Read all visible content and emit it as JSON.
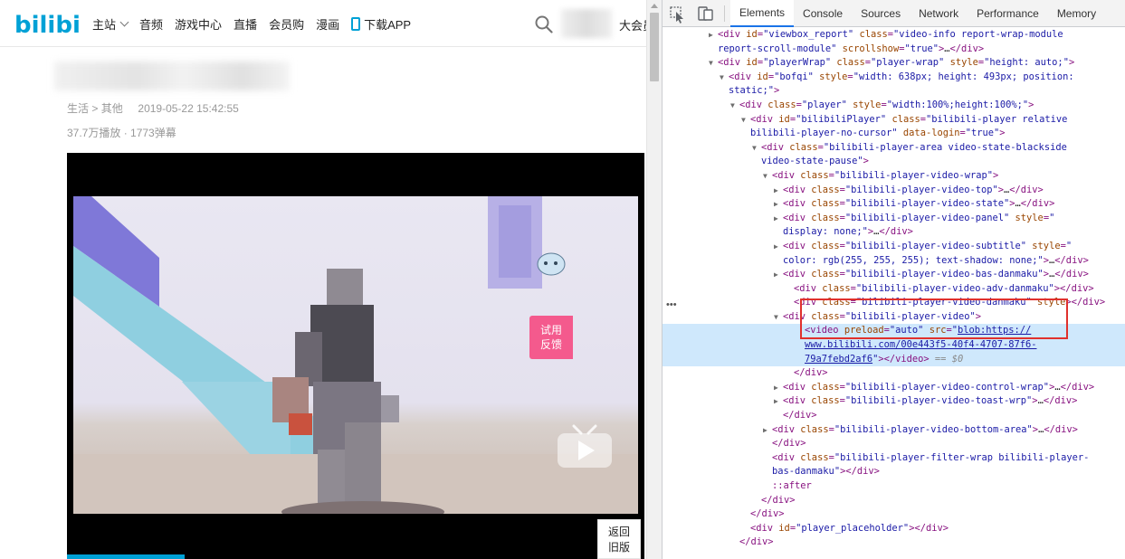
{
  "site": {
    "logo_text": "bilibili",
    "nav": [
      {
        "label": "主站",
        "has_chevron": true
      },
      {
        "label": "音频"
      },
      {
        "label": "游戏中心"
      },
      {
        "label": "直播"
      },
      {
        "label": "会员购"
      },
      {
        "label": "漫画"
      },
      {
        "label": "下载APP",
        "icon": "phone-icon"
      }
    ],
    "header_right_text": "大会员",
    "search_icon": "search-icon",
    "breadcrumb": {
      "part1": "生活",
      "sep": " > ",
      "part2": "其他",
      "timestamp": "2019-05-22 15:42:55"
    },
    "stats": {
      "plays": "37.7万播放",
      "sep": " · ",
      "danmaku": "1773弹幕"
    },
    "feedback_button": {
      "line1": "试用",
      "line2": "反馈"
    },
    "back_old_button": {
      "line1": "返回",
      "line2": "旧版"
    }
  },
  "devtools": {
    "tabs": [
      "Elements",
      "Console",
      "Sources",
      "Network",
      "Performance",
      "Memory"
    ],
    "active_tab": "Elements",
    "icons": [
      "inspect-icon",
      "device-icon"
    ],
    "dom_lines": [
      {
        "indent": 62,
        "tri": "▶",
        "html": "<span class=\"tn\">&lt;div</span> <span class=\"an\">id</span>=<span class=\"av\">\"viewbox_report\"</span> <span class=\"an\">class</span>=<span class=\"av\">\"video-info report-wrap-module</span>"
      },
      {
        "indent": 62,
        "tri": "",
        "html": "<span class=\"av\">report-scroll-module\"</span> <span class=\"an\">scrollshow</span>=<span class=\"av\">\"true\"</span><span class=\"tn\">&gt;</span><span class=\"tx\">…</span><span class=\"tn\">&lt;/div&gt;</span>"
      },
      {
        "indent": 62,
        "tri": "▼",
        "html": "<span class=\"tn\">&lt;div</span> <span class=\"an\">id</span>=<span class=\"av\">\"playerWrap\"</span> <span class=\"an\">class</span>=<span class=\"av\">\"player-wrap\"</span> <span class=\"an\">style</span>=<span class=\"av\">\"height: auto;\"</span><span class=\"tn\">&gt;</span>"
      },
      {
        "indent": 74,
        "tri": "▼",
        "html": "<span class=\"tn\">&lt;div</span> <span class=\"an\">id</span>=<span class=\"av\">\"bofqi\"</span> <span class=\"an\">style</span>=<span class=\"av\">\"width: 638px; height: 493px; position:</span>"
      },
      {
        "indent": 74,
        "tri": "",
        "html": "<span class=\"av\">static;\"</span><span class=\"tn\">&gt;</span>"
      },
      {
        "indent": 86,
        "tri": "▼",
        "html": "<span class=\"tn\">&lt;div</span> <span class=\"an\">class</span>=<span class=\"av\">\"player\"</span> <span class=\"an\">style</span>=<span class=\"av\">\"width:100%;height:100%;\"</span><span class=\"tn\">&gt;</span>"
      },
      {
        "indent": 98,
        "tri": "▼",
        "html": "<span class=\"tn\">&lt;div</span> <span class=\"an\">id</span>=<span class=\"av\">\"bilibiliPlayer\"</span> <span class=\"an\">class</span>=<span class=\"av\">\"bilibili-player relative</span>"
      },
      {
        "indent": 98,
        "tri": "",
        "html": "<span class=\"av\">bilibili-player-no-cursor\"</span> <span class=\"an\">data-login</span>=<span class=\"av\">\"true\"</span><span class=\"tn\">&gt;</span>"
      },
      {
        "indent": 110,
        "tri": "▼",
        "html": "<span class=\"tn\">&lt;div</span> <span class=\"an\">class</span>=<span class=\"av\">\"bilibili-player-area video-state-blackside</span>"
      },
      {
        "indent": 110,
        "tri": "",
        "html": "<span class=\"av\">video-state-pause\"</span><span class=\"tn\">&gt;</span>"
      },
      {
        "indent": 122,
        "tri": "▼",
        "html": "<span class=\"tn\">&lt;div</span> <span class=\"an\">class</span>=<span class=\"av\">\"bilibili-player-video-wrap\"</span><span class=\"tn\">&gt;</span>"
      },
      {
        "indent": 134,
        "tri": "▶",
        "html": "<span class=\"tn\">&lt;div</span> <span class=\"an\">class</span>=<span class=\"av\">\"bilibili-player-video-top\"</span><span class=\"tn\">&gt;</span><span class=\"tx\">…</span><span class=\"tn\">&lt;/div&gt;</span>"
      },
      {
        "indent": 134,
        "tri": "▶",
        "html": "<span class=\"tn\">&lt;div</span> <span class=\"an\">class</span>=<span class=\"av\">\"bilibili-player-video-state\"</span><span class=\"tn\">&gt;</span><span class=\"tx\">…</span><span class=\"tn\">&lt;/div&gt;</span>"
      },
      {
        "indent": 134,
        "tri": "▶",
        "html": "<span class=\"tn\">&lt;div</span> <span class=\"an\">class</span>=<span class=\"av\">\"bilibili-player-video-panel\"</span> <span class=\"an\">style</span>=<span class=\"av\">\"</span>"
      },
      {
        "indent": 134,
        "tri": "",
        "html": "<span class=\"av\">display: none;\"</span><span class=\"tn\">&gt;</span><span class=\"tx\">…</span><span class=\"tn\">&lt;/div&gt;</span>"
      },
      {
        "indent": 134,
        "tri": "▶",
        "html": "<span class=\"tn\">&lt;div</span> <span class=\"an\">class</span>=<span class=\"av\">\"bilibili-player-video-subtitle\"</span> <span class=\"an\">style</span>=<span class=\"av\">\"</span>"
      },
      {
        "indent": 134,
        "tri": "",
        "html": "<span class=\"av\">color: rgb(255, 255, 255); text-shadow: none;\"</span><span class=\"tn\">&gt;</span><span class=\"tx\">…</span><span class=\"tn\">&lt;/div&gt;</span>"
      },
      {
        "indent": 134,
        "tri": "▶",
        "html": "<span class=\"tn\">&lt;div</span> <span class=\"an\">class</span>=<span class=\"av\">\"bilibili-player-video-bas-danmaku\"</span><span class=\"tn\">&gt;</span><span class=\"tx\">…</span><span class=\"tn\">&lt;/div&gt;</span>"
      },
      {
        "indent": 146,
        "tri": "",
        "html": "<span class=\"tn\">&lt;div</span> <span class=\"an\">class</span>=<span class=\"av\">\"bilibili-player-video-adv-danmaku\"</span><span class=\"tn\">&gt;&lt;/div&gt;</span>"
      },
      {
        "indent": 146,
        "tri": "",
        "html": "<span class=\"tn\">&lt;div</span> <span class=\"an\">class</span>=<span class=\"av\">\"bilibili-player-video-danmaku\"</span> <span class=\"an\">style</span><span class=\"tn\">&gt;&lt;/div&gt;</span>"
      },
      {
        "indent": 134,
        "tri": "▼",
        "html": "<span class=\"tn\">&lt;div</span> <span class=\"an\">class</span>=<span class=\"av\">\"bilibili-player-video\"</span><span class=\"tn\">&gt;</span>"
      },
      {
        "indent": 158,
        "tri": "",
        "sel": true,
        "html": "<span class=\"tn\">&lt;video</span> <span class=\"an\">preload</span>=<span class=\"av\">\"auto\"</span> <span class=\"an\">src</span>=<span class=\"av\">\"</span><span class=\"lk\">blob:https://</span>"
      },
      {
        "indent": 158,
        "tri": "",
        "sel": true,
        "html": "<span class=\"lk\">www.bilibili.com/00e443f5-40f4-4707-87f6-</span>"
      },
      {
        "indent": 158,
        "tri": "",
        "sel": true,
        "html": "<span class=\"lk\">79a7febd2af6</span><span class=\"av\">\"</span><span class=\"tn\">&gt;&lt;/video&gt;</span> <span class=\"eq\">== $0</span>"
      },
      {
        "indent": 146,
        "tri": "",
        "html": "<span class=\"tn\">&lt;/div&gt;</span>"
      },
      {
        "indent": 134,
        "tri": "▶",
        "html": "<span class=\"tn\">&lt;div</span> <span class=\"an\">class</span>=<span class=\"av\">\"bilibili-player-video-control-wrap\"</span><span class=\"tn\">&gt;</span><span class=\"tx\">…</span><span class=\"tn\">&lt;/div&gt;</span>"
      },
      {
        "indent": 134,
        "tri": "▶",
        "html": "<span class=\"tn\">&lt;div</span> <span class=\"an\">class</span>=<span class=\"av\">\"bilibili-player-video-toast-wrp\"</span><span class=\"tn\">&gt;</span><span class=\"tx\">…</span><span class=\"tn\">&lt;/div&gt;</span>"
      },
      {
        "indent": 134,
        "tri": "",
        "html": "<span class=\"tn\">&lt;/div&gt;</span>"
      },
      {
        "indent": 122,
        "tri": "▶",
        "html": "<span class=\"tn\">&lt;div</span> <span class=\"an\">class</span>=<span class=\"av\">\"bilibili-player-video-bottom-area\"</span><span class=\"tn\">&gt;</span><span class=\"tx\">…</span><span class=\"tn\">&lt;/div&gt;</span>"
      },
      {
        "indent": 122,
        "tri": "",
        "html": "<span class=\"tn\">&lt;/div&gt;</span>"
      },
      {
        "indent": 122,
        "tri": "",
        "html": "<span class=\"tn\">&lt;div</span> <span class=\"an\">class</span>=<span class=\"av\">\"bilibili-player-filter-wrap bilibili-player-</span>"
      },
      {
        "indent": 122,
        "tri": "",
        "html": "<span class=\"av\">bas-danmaku\"</span><span class=\"tn\">&gt;&lt;/div&gt;</span>"
      },
      {
        "indent": 122,
        "tri": "",
        "html": "<span class=\"tn\">::after</span>"
      },
      {
        "indent": 110,
        "tri": "",
        "html": "<span class=\"tn\">&lt;/div&gt;</span>"
      },
      {
        "indent": 98,
        "tri": "",
        "html": "<span class=\"tn\">&lt;/div&gt;</span>"
      },
      {
        "indent": 98,
        "tri": "",
        "html": "<span class=\"tn\">&lt;div</span> <span class=\"an\">id</span>=<span class=\"av\">\"player_placeholder\"</span><span class=\"tn\">&gt;&lt;/div&gt;</span>"
      },
      {
        "indent": 86,
        "tri": "",
        "html": "<span class=\"tn\">&lt;/div&gt;</span>"
      }
    ]
  },
  "colors": {
    "brand": "#00a1d6",
    "feedback": "#f45a8d",
    "highlight": "#e0312d",
    "selection": "#cfe8fc"
  }
}
